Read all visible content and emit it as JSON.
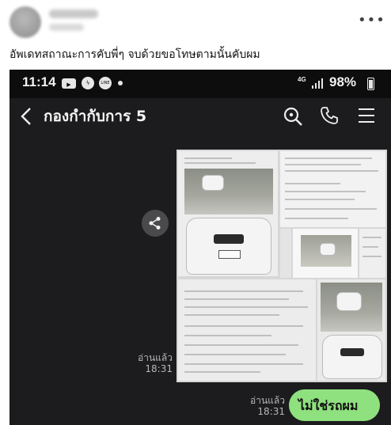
{
  "post": {
    "caption": "อัพเดทสถาณะการคับพี่ๆ  จบด้วยขอโทษตามนั้นคับผม",
    "more_icon": "more-horizontal-icon"
  },
  "status_bar": {
    "time": "11:14",
    "network": "4G",
    "battery": "98%"
  },
  "chat": {
    "title": "กองกำกับการ 5",
    "icons": [
      "back-icon",
      "search-icon",
      "phone-icon",
      "menu-icon"
    ]
  },
  "messages": [
    {
      "type": "image",
      "side": "right",
      "read_label": "อ่านแล้ว",
      "time": "18:31"
    },
    {
      "type": "text",
      "side": "right",
      "text": "ไม่ใช่รถผม",
      "read_label": "อ่านแล้ว",
      "time": "18:31"
    }
  ],
  "colors": {
    "chat_bg": "#1c1c1e",
    "bubble_bg": "#8fe07e"
  }
}
